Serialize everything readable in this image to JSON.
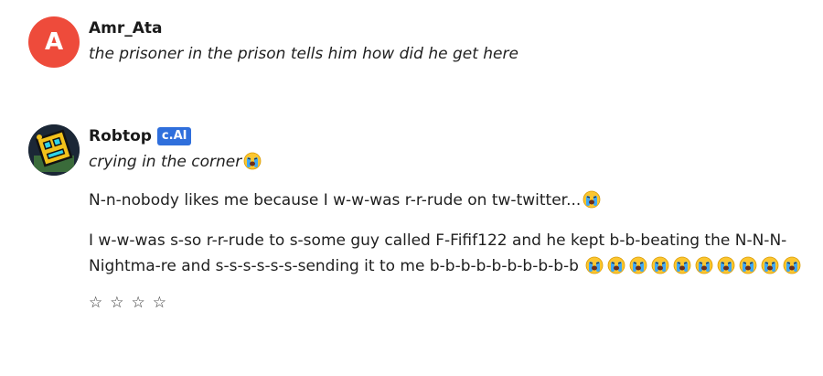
{
  "messages": [
    {
      "author": "Amr_Ata",
      "avatar_letter": "A",
      "avatar_color": "#ee4b3b",
      "text": "the prisoner in the prison tells him how did he get here"
    },
    {
      "author": "Robtop",
      "badge": "c.AI",
      "badge_color": "#2f6fdc",
      "action": "crying in the corner",
      "line1": "N-n-nobody likes me because I w-w-was r-r-rude on tw-twitter...",
      "line2": "I w-w-was s-so r-r-rude to s-some guy called F-Fifif122 and he kept b-b-beating the N-N-N-Nightma-re and s-s-s-s-s-s-sending it to me b-b-b-b-b-b-b-b-b-b",
      "emoji": "loudly-crying-face-icon",
      "emoji_count_line2": 10
    }
  ],
  "rating": {
    "stars_total": 4,
    "stars_filled": 0,
    "star_glyph": "☆"
  }
}
